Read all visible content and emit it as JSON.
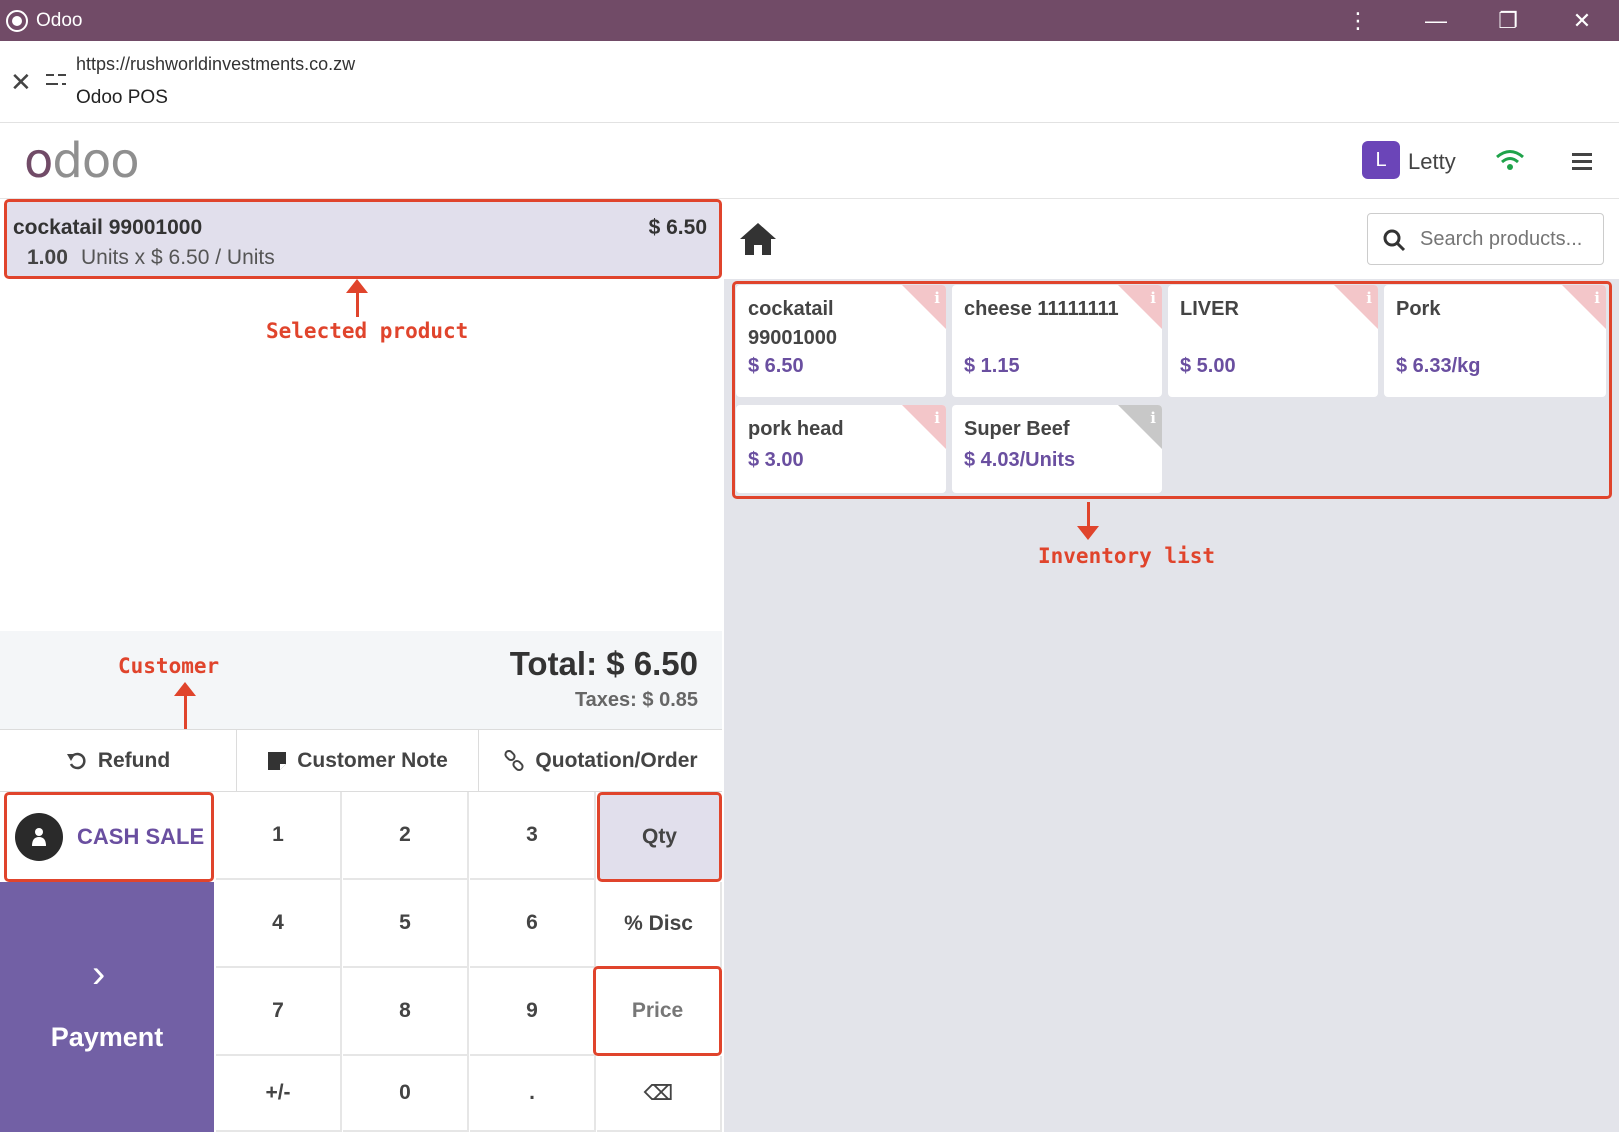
{
  "window": {
    "title": "Odoo",
    "menu_dots": "⋮",
    "minimize": "—",
    "restore": "❐",
    "close": "✕"
  },
  "address": {
    "url": "https://rushworldinvestments.co.zw",
    "page_title": "Odoo POS"
  },
  "header": {
    "logo": "odoo",
    "user_initial": "L",
    "user_name": "Letty"
  },
  "order": {
    "line": {
      "name": "cockatail 99001000",
      "price": "$ 6.50",
      "qty": "1.00",
      "unit_detail": "Units x $ 6.50 / Units"
    },
    "total": "Total: $ 6.50",
    "taxes": "Taxes: $ 0.85"
  },
  "controls": {
    "refund": "Refund",
    "customer_note": "Customer Note",
    "quotation": "Quotation/Order"
  },
  "customer": {
    "label": "CASH SALE"
  },
  "payment": {
    "chevron": "›",
    "label": "Payment"
  },
  "numpad": {
    "k1": "1",
    "k2": "2",
    "k3": "3",
    "qty": "Qty",
    "k4": "4",
    "k5": "5",
    "k6": "6",
    "disc": "% Disc",
    "k7": "7",
    "k8": "8",
    "k9": "9",
    "price": "Price",
    "sign": "+/-",
    "k0": "0",
    "dot": ".",
    "backspace": "⌫"
  },
  "search": {
    "placeholder": "Search products..."
  },
  "products": [
    {
      "name_line1": "cockatail",
      "name_line2": "99001000",
      "price": "$ 6.50"
    },
    {
      "name_line1": "cheese 11111111",
      "price": "$ 1.15"
    },
    {
      "name_line1": "LIVER",
      "price": "$ 5.00"
    },
    {
      "name_line1": "Pork",
      "price": "$ 6.33/kg"
    },
    {
      "name_line1": "pork head",
      "price": "$ 3.00"
    },
    {
      "name_line1": "Super Beef",
      "price": "$ 4.03/Units"
    }
  ],
  "info_glyph": "i",
  "annotations": {
    "selected_product": "Selected product",
    "inventory_list": "Inventory list",
    "customer": "Customer"
  },
  "colors": {
    "brand": "#714b67",
    "accent": "#7260a5",
    "annotation": "#e0442c",
    "selected_bg": "#e1dfec"
  }
}
